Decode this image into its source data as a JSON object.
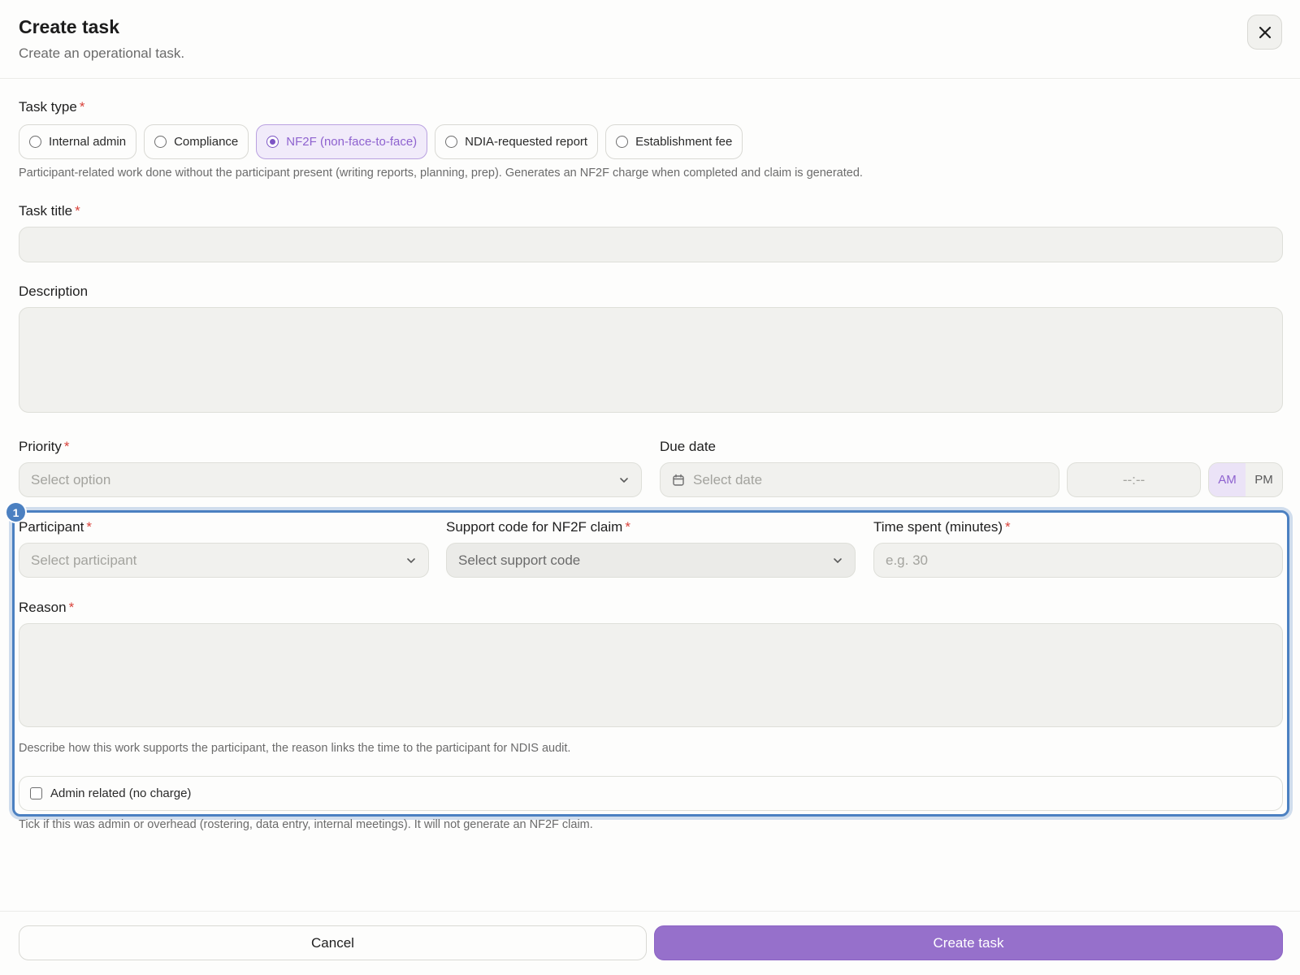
{
  "header": {
    "title": "Create task",
    "subtitle": "Create an operational task."
  },
  "task_type": {
    "label": "Task type",
    "options": [
      {
        "label": "Internal admin",
        "selected": false
      },
      {
        "label": "Compliance",
        "selected": false
      },
      {
        "label": "NF2F (non-face-to-face)",
        "selected": true
      },
      {
        "label": "NDIA-requested report",
        "selected": false
      },
      {
        "label": "Establishment fee",
        "selected": false
      }
    ],
    "hint": "Participant-related work done without the participant present (writing reports, planning, prep). Generates an NF2F charge when completed and claim is generated."
  },
  "task_title": {
    "label": "Task title",
    "value": ""
  },
  "description": {
    "label": "Description",
    "value": ""
  },
  "priority": {
    "label": "Priority",
    "placeholder": "Select option"
  },
  "due_date": {
    "label": "Due date",
    "date_placeholder": "Select date",
    "time_placeholder": "--:--",
    "am_label": "AM",
    "pm_label": "PM",
    "selected_period": "AM"
  },
  "highlight": {
    "badge": "1"
  },
  "participant": {
    "label": "Participant",
    "placeholder": "Select participant"
  },
  "support_code": {
    "label": "Support code for NF2F claim",
    "placeholder": "Select support code"
  },
  "time_spent": {
    "label": "Time spent (minutes)",
    "placeholder": "e.g. 30"
  },
  "reason": {
    "label": "Reason",
    "value": "",
    "hint": "Describe how this work supports the participant, the reason links the time to the participant for NDIS audit."
  },
  "admin_related": {
    "label": "Admin related (no charge)",
    "checked": false,
    "hint": "Tick if this was admin or overhead (rostering, data entry, internal meetings). It will not generate an NF2F claim."
  },
  "footer": {
    "cancel_label": "Cancel",
    "create_label": "Create task"
  },
  "colors": {
    "accent": "#9670cb",
    "required": "#d9423a",
    "highlight": "#4b80c1"
  }
}
